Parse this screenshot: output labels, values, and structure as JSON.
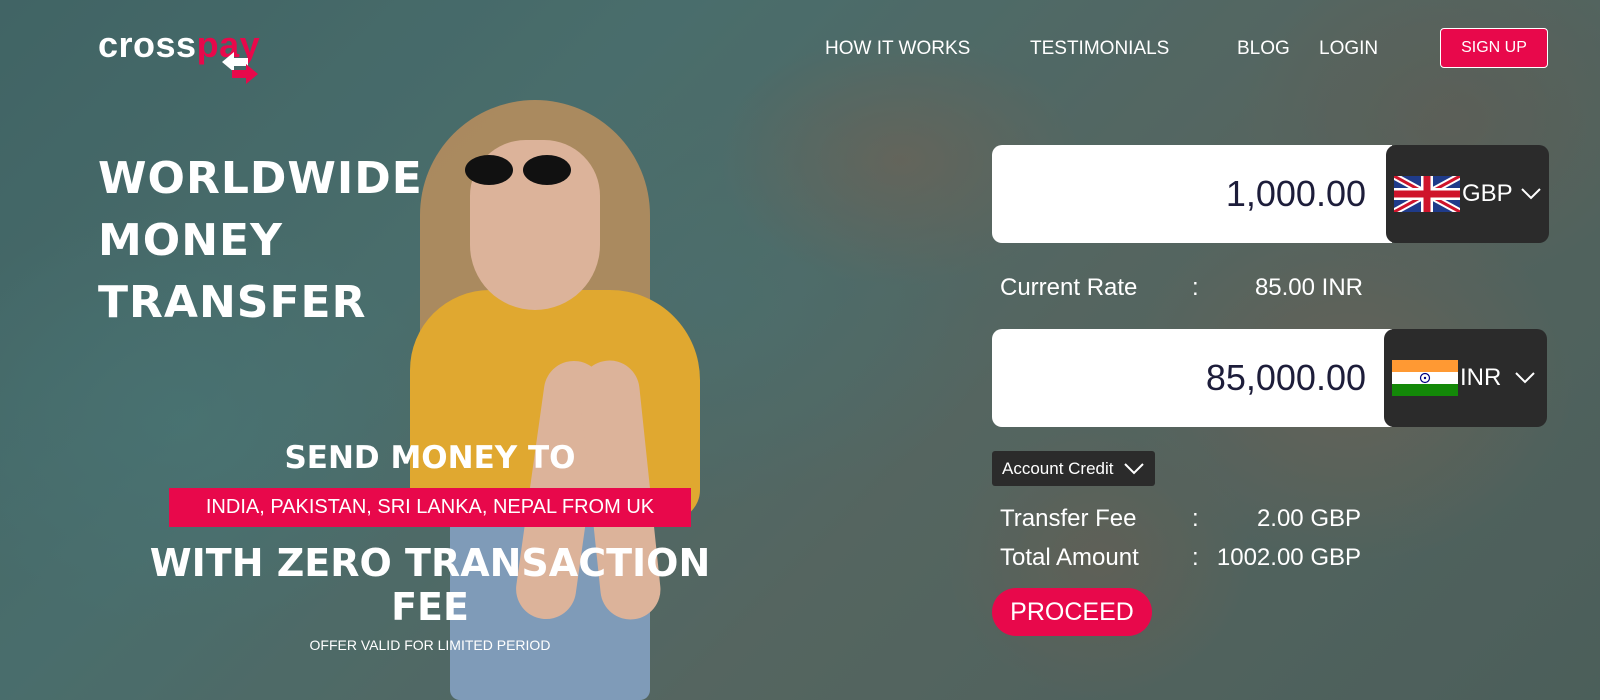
{
  "brand": {
    "logo_part1": "cross",
    "logo_part2": "pay"
  },
  "nav": {
    "how_it_works": "HOW IT WORKS",
    "testimonials": "TESTIMONIALS",
    "blog": "BLOG",
    "login": "LOGIN",
    "signup": "SIGN UP"
  },
  "hero": {
    "line1": "WORLDWIDE",
    "line2": "MONEY",
    "line3": "TRANSFER",
    "send_to": "SEND MONEY TO",
    "countries": "INDIA, PAKISTAN, SRI LANKA, NEPAL FROM UK",
    "zero_fee": "WITH ZERO TRANSACTION FEE",
    "offer": "OFFER VALID FOR LIMITED PERIOD"
  },
  "converter": {
    "send_amount": "1,000.00",
    "send_currency": "GBP",
    "rate_label": "Current Rate",
    "rate_value": "85.00 INR",
    "receive_amount": "85,000.00",
    "receive_currency": "INR",
    "method": "Account Credit",
    "fee_label": "Transfer Fee",
    "fee_value": "2.00 GBP",
    "total_label": "Total Amount",
    "total_value": "1002.00 GBP",
    "colon": ":",
    "proceed": "PROCEED"
  },
  "colors": {
    "accent": "#e8084b",
    "dark_panel": "#2b2b2b"
  },
  "icons": {
    "send_flag": "uk-flag-icon",
    "receive_flag": "india-flag-icon",
    "dropdown": "chevron-down-icon",
    "logo": "exchange-arrows-icon"
  }
}
